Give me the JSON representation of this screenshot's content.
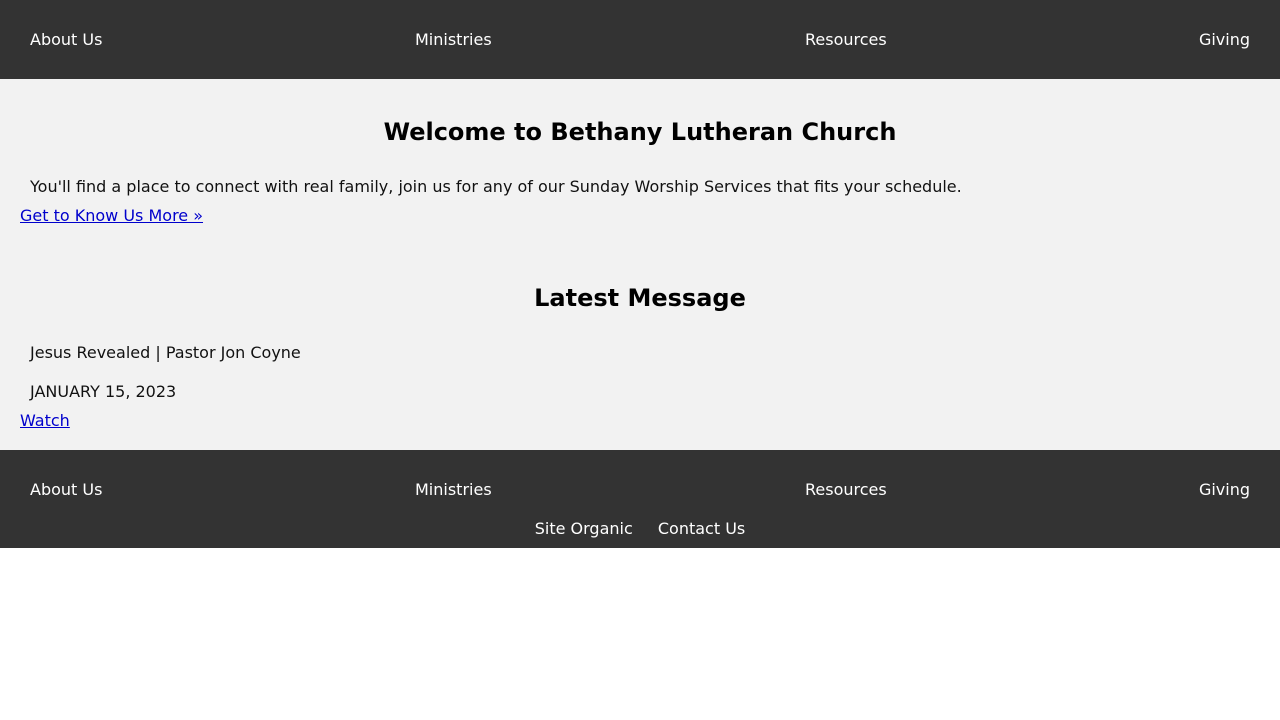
{
  "top_nav": {
    "items": [
      {
        "label": "About Us"
      },
      {
        "label": "Ministries"
      },
      {
        "label": "Resources"
      },
      {
        "label": "Giving"
      }
    ]
  },
  "welcome": {
    "title": "Welcome to Bethany Lutheran Church",
    "body": "You'll find a place to connect with real family, join us for any of our Sunday Worship Services that fits your schedule.",
    "link": "Get to Know Us More »"
  },
  "latest_message": {
    "title": "Latest Message",
    "message_title": "Jesus Revealed | Pastor Jon Coyne",
    "date": "JANUARY 15, 2023",
    "link": "Watch"
  },
  "footer": {
    "items": [
      {
        "label": "About Us"
      },
      {
        "label": "Ministries"
      },
      {
        "label": "Resources"
      },
      {
        "label": "Giving"
      }
    ],
    "secondary": [
      {
        "label": "Site Organic"
      },
      {
        "label": "Contact Us"
      }
    ]
  },
  "colors": {
    "nav_background": "#333333",
    "main_background": "#f2f2f2",
    "link": "#0000cc"
  }
}
